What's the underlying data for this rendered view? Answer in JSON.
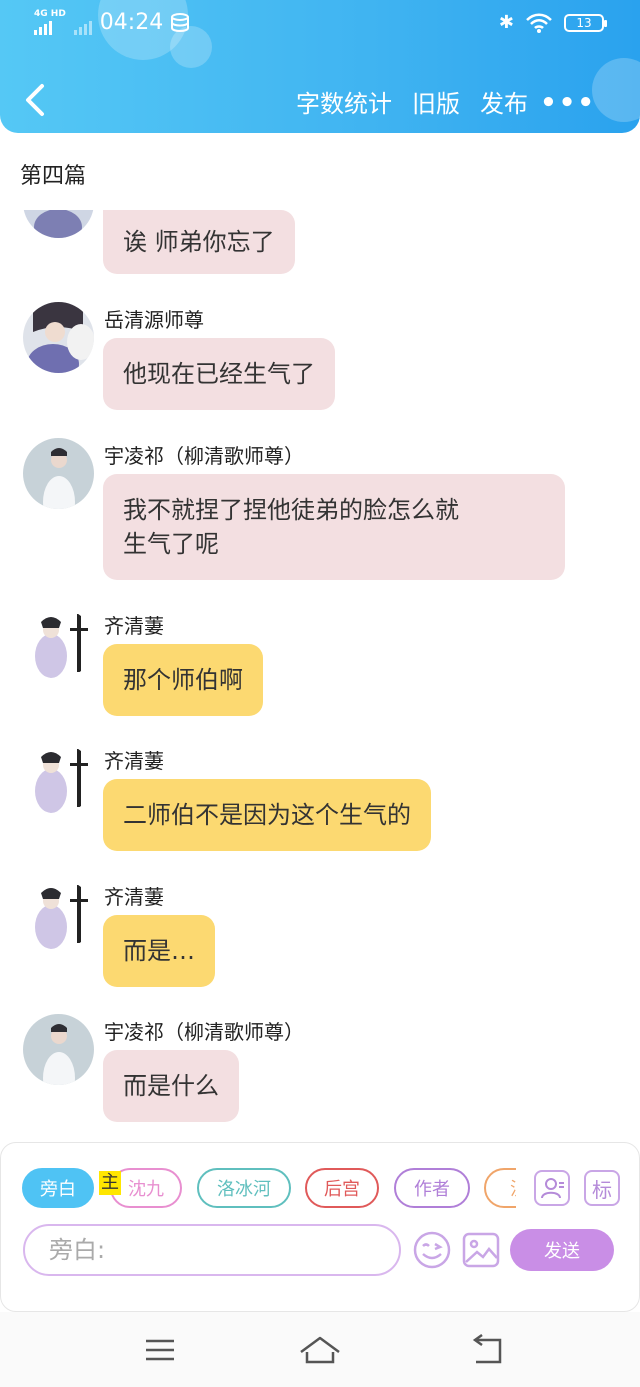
{
  "status_bar": {
    "network": "4G HD",
    "time": "04:24",
    "battery": "13"
  },
  "nav": {
    "word_count": "字数统计",
    "old_version": "旧版",
    "publish": "发布",
    "more": "•••"
  },
  "chapter_title": "第四篇",
  "messages": [
    {
      "name": "",
      "text": "诶 师弟你忘了",
      "color": "pink",
      "avatar": "yue-avatar"
    },
    {
      "name": "岳清源师尊",
      "text": "他现在已经生气了",
      "color": "pink",
      "avatar": "yue-avatar"
    },
    {
      "name": "宇凌祁（柳清歌师尊）",
      "text_line1": "我不就捏了捏他徒弟的脸怎么就",
      "text_line2": "生气了呢",
      "color": "pink",
      "avatar": "yu-avatar"
    },
    {
      "name": "齐清萋",
      "text": "那个师伯啊",
      "color": "yellow",
      "avatar": "qi-avatar"
    },
    {
      "name": "齐清萋",
      "text": "二师伯不是因为这个生气的",
      "color": "yellow",
      "avatar": "qi-avatar"
    },
    {
      "name": "齐清萋",
      "text": "而是…",
      "color": "yellow",
      "avatar": "qi-avatar"
    },
    {
      "name": "宇凌祁（柳清歌师尊）",
      "text": "而是什么",
      "color": "pink",
      "avatar": "yu-avatar"
    }
  ],
  "role_chips": [
    {
      "label": "旁白",
      "color": "#4fc3f4"
    },
    {
      "label": "沈九",
      "color": "#e88fd0"
    },
    {
      "label": "洛冰河",
      "color": "#5fbfbe"
    },
    {
      "label": "后宫",
      "color": "#e05a5a"
    },
    {
      "label": "作者",
      "color": "#b07fd8"
    },
    {
      "label": "沈",
      "color": "#f0a56a"
    }
  ],
  "main_tag": "主",
  "side_icons": {
    "contact": "contact-icon",
    "tag_label": "标"
  },
  "input": {
    "placeholder": "旁白:"
  },
  "send_label": "发送",
  "colors": {
    "header": "#3fb3f1",
    "pink_bubble": "#f3dfe1",
    "yellow_bubble": "#fcd971",
    "send": "#c98ee6"
  }
}
